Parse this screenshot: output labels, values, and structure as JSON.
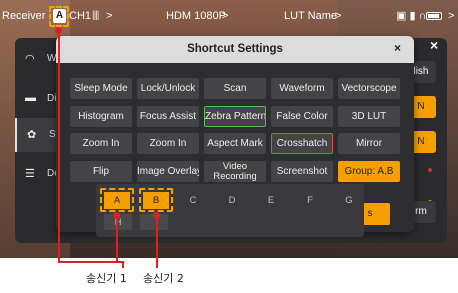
{
  "status_bar": {
    "receiver": "Receiver",
    "chip": "A",
    "channel": "CH1",
    "signal_icon": "signal-bars-icon",
    "video": "HDM 1080P",
    "lut": "LUT Name",
    "arrow": ">"
  },
  "sidebar": {
    "items": [
      {
        "label": "Wi",
        "icon": "wifi-icon"
      },
      {
        "label": "Di",
        "icon": "display-icon"
      },
      {
        "label": "Sy",
        "icon": "gear-icon"
      },
      {
        "label": "De",
        "icon": "device-icon"
      }
    ]
  },
  "right_panel": {
    "close": "×",
    "btn1": "lish",
    "btn2": "N",
    "btn3": "N",
    "btn4": "rm"
  },
  "dialog": {
    "title": "Shortcut Settings",
    "close": "×",
    "buttons": [
      "Sleep Mode",
      "Lock/Unlock",
      "Scan",
      "Waveform",
      "Vectorscope",
      "Histogram",
      "Focus Assist",
      "Zebra Pattern",
      "False Color",
      "3D LUT",
      "Zoom In",
      "Zoom In",
      "Aspect Mark",
      "Crosshatch",
      "Mirror",
      "Flip",
      "Image Overlay",
      "Video\nRecording",
      "Screenshot",
      "Group: A,B"
    ],
    "groups": [
      "A",
      "B",
      "C",
      "D",
      "E",
      "F",
      "G",
      "H",
      ""
    ],
    "ok": "s"
  },
  "annotations": {
    "label1": "송신기 1",
    "label2": "송신기 2",
    "color": "#e02020"
  },
  "colors": {
    "accent": "#f5a000",
    "zebra_border": "#5cb85c",
    "crosshatch_border": "#d9534f"
  }
}
